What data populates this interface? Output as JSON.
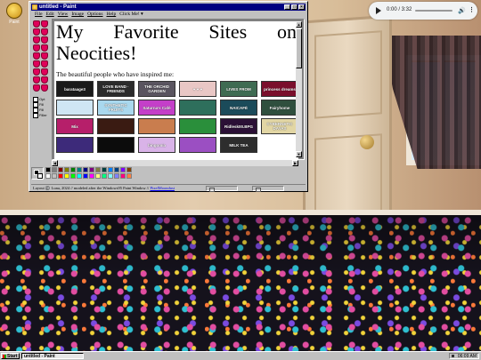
{
  "desktop": {
    "icon_label": "Paint"
  },
  "player": {
    "time": "0:00 / 3:32"
  },
  "window": {
    "title": "untitled - Paint",
    "menu": [
      "File",
      "Edit",
      "View",
      "Image",
      "Options",
      "Help",
      "Click Me! ▾"
    ],
    "canvas": {
      "heading_line1": "My Favorite Sites on",
      "heading_line2": "Neocities!",
      "subtitle": "The beautiful people who have inspired me:",
      "buttons": [
        {
          "label": "barataage3",
          "bg": "#1a1a1a"
        },
        {
          "label": "LOVE BAND · FRIENDS",
          "bg": "#2b2b2b"
        },
        {
          "label": "THE ORCHID GARDEN",
          "bg": "#5a5560"
        },
        {
          "label": "♥ ♥ ♥",
          "bg": "#e9c7c5"
        },
        {
          "label": "LIVES FROM",
          "bg": "#3f6b52"
        },
        {
          "label": "princess dreams",
          "bg": "#7a0f2c"
        },
        {
          "label": "",
          "bg": "#cfe6f4"
        },
        {
          "label": "SYNTHETIC FRUITS",
          "bg": "#a9d8ee"
        },
        {
          "label": "Saturna's Café",
          "bg": "#c43fc9"
        },
        {
          "label": "",
          "bg": "#2e6f5c"
        },
        {
          "label": "NAICAFÉ",
          "bg": "#1b4b5a"
        },
        {
          "label": "Fairyhome",
          "bg": "#2f4f3e"
        },
        {
          "label": "Mix",
          "bg": "#b61f6a"
        },
        {
          "label": "",
          "bg": "#3a1b12"
        },
        {
          "label": "",
          "bg": "#c97d4e"
        },
        {
          "label": "",
          "bg": "#2a8f3b"
        },
        {
          "label": "Ridlesk00.BPG",
          "bg": "#2b1036"
        },
        {
          "label": "CYBERNETIC DAYAS",
          "bg": "#e2d6a4"
        },
        {
          "label": "",
          "bg": "#3d2a7a"
        },
        {
          "label": "",
          "bg": "#0c0c0c"
        },
        {
          "label": "bingomia",
          "bg": "#d9b3e8"
        },
        {
          "label": "",
          "bg": "#9b4fc2"
        },
        {
          "label": "MILK TEA",
          "bg": "#2d2d2d"
        }
      ]
    },
    "tool_options": [
      "Opt",
      "Fill",
      "Fill",
      "Filler"
    ],
    "palette": [
      "#000000",
      "#808080",
      "#800000",
      "#808000",
      "#008000",
      "#008080",
      "#000080",
      "#800080",
      "#808040",
      "#004040",
      "#0080ff",
      "#004080",
      "#8000ff",
      "#804000",
      "#ffffff",
      "#c0c0c0",
      "#ff0000",
      "#ffff00",
      "#00ff00",
      "#00ffff",
      "#0000ff",
      "#ff00ff",
      "#ffff80",
      "#00ff80",
      "#80ffff",
      "#8080ff",
      "#ff0080",
      "#ff8040"
    ],
    "status": {
      "credit_text": "Layout ©️ Luna, 2024 // modeled after the Windows95 Paint Window // ",
      "credit_link": "PixelMoondust"
    }
  },
  "taskbar": {
    "start_label": "Start",
    "task_label": "untitled - Paint",
    "clock": "06:09 AM"
  }
}
